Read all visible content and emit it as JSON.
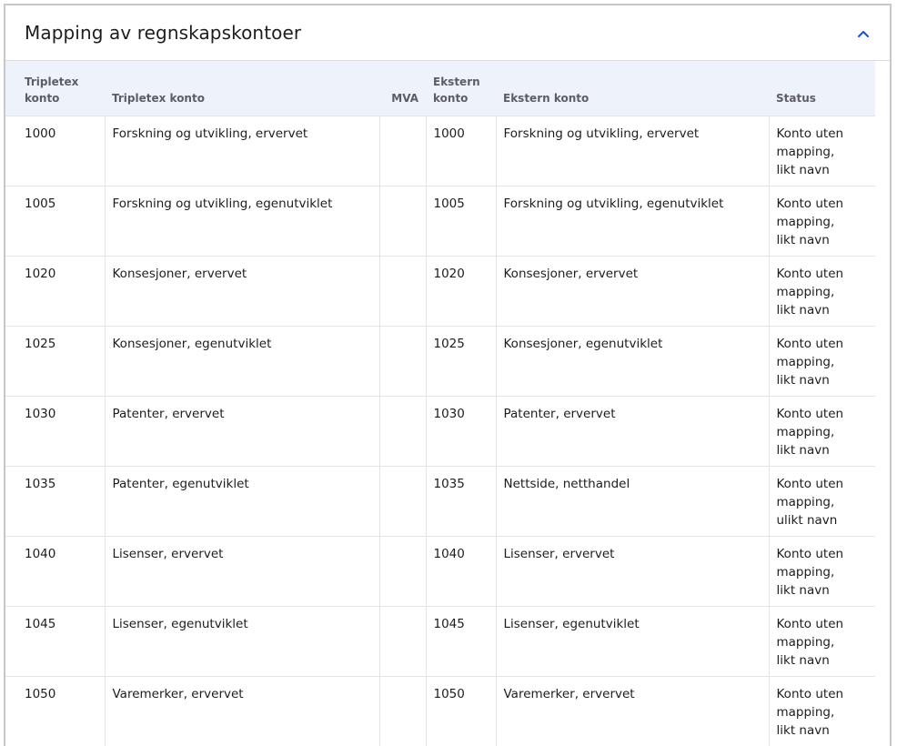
{
  "panel": {
    "title": "Mapping av regnskapskontoer",
    "collapse_icon": "chevron-up-icon",
    "accent_color": "#1a4fd6"
  },
  "table": {
    "headers": {
      "tripletex_no": "Tripletex konto",
      "tripletex_name": "Tripletex konto",
      "mva": "MVA",
      "ekstern_no": "Ekstern konto",
      "ekstern_name": "Ekstern konto",
      "status": "Status"
    },
    "rows": [
      {
        "tno": "1000",
        "tname": "Forskning og utvikling, ervervet",
        "mva": "",
        "eno": "1000",
        "ename": "Forskning og utvikling, ervervet",
        "status": "Konto uten mapping, likt navn"
      },
      {
        "tno": "1005",
        "tname": "Forskning og utvikling, egenutviklet",
        "mva": "",
        "eno": "1005",
        "ename": "Forskning og utvikling, egenutviklet",
        "status": "Konto uten mapping, likt navn"
      },
      {
        "tno": "1020",
        "tname": "Konsesjoner, ervervet",
        "mva": "",
        "eno": "1020",
        "ename": "Konsesjoner, ervervet",
        "status": "Konto uten mapping, likt navn"
      },
      {
        "tno": "1025",
        "tname": "Konsesjoner, egenutviklet",
        "mva": "",
        "eno": "1025",
        "ename": "Konsesjoner, egenutviklet",
        "status": "Konto uten mapping, likt navn"
      },
      {
        "tno": "1030",
        "tname": "Patenter, ervervet",
        "mva": "",
        "eno": "1030",
        "ename": "Patenter, ervervet",
        "status": "Konto uten mapping, likt navn"
      },
      {
        "tno": "1035",
        "tname": "Patenter, egenutviklet",
        "mva": "",
        "eno": "1035",
        "ename": "Nettside, netthandel",
        "status": "Konto uten mapping, ulikt navn"
      },
      {
        "tno": "1040",
        "tname": "Lisenser, ervervet",
        "mva": "",
        "eno": "1040",
        "ename": "Lisenser, ervervet",
        "status": "Konto uten mapping, likt navn"
      },
      {
        "tno": "1045",
        "tname": "Lisenser, egenutviklet",
        "mva": "",
        "eno": "1045",
        "ename": "Lisenser, egenutviklet",
        "status": "Konto uten mapping, likt navn"
      },
      {
        "tno": "1050",
        "tname": "Varemerker, ervervet",
        "mva": "",
        "eno": "1050",
        "ename": "Varemerker, ervervet",
        "status": "Konto uten mapping, likt navn"
      }
    ]
  }
}
